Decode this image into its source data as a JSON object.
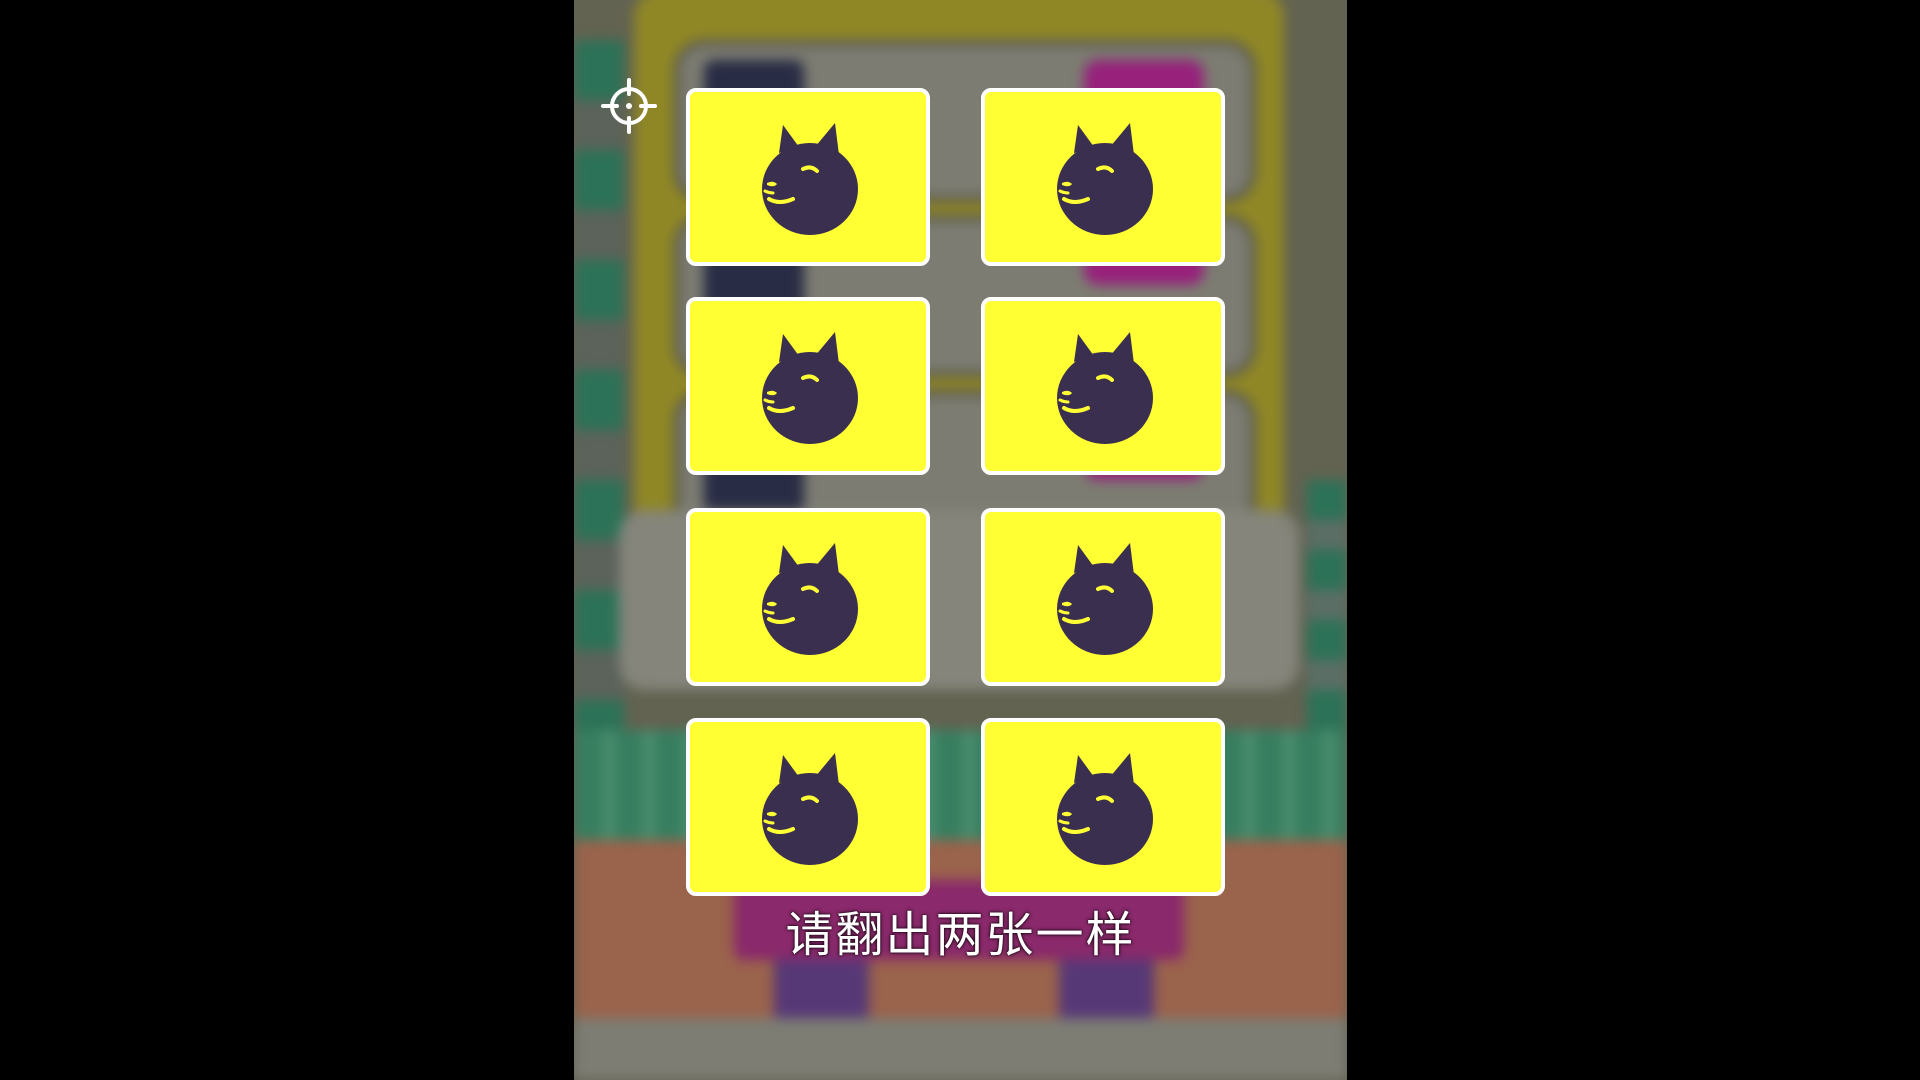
{
  "game": {
    "hint": "请翻出两张一样",
    "card_back_color": "#ffff33",
    "card_border_color": "#ffffff",
    "dog_color": "#3a2f4f",
    "cards": [
      {
        "icon": "doge-head-icon",
        "state": "face-down"
      },
      {
        "icon": "doge-head-icon",
        "state": "face-down"
      },
      {
        "icon": "doge-head-icon",
        "state": "face-down"
      },
      {
        "icon": "doge-head-icon",
        "state": "face-down"
      },
      {
        "icon": "doge-head-icon",
        "state": "face-down"
      },
      {
        "icon": "doge-head-icon",
        "state": "face-down"
      },
      {
        "icon": "doge-head-icon",
        "state": "face-down"
      },
      {
        "icon": "doge-head-icon",
        "state": "face-down"
      }
    ]
  },
  "controls": {
    "locate_icon": "crosshair-icon"
  }
}
